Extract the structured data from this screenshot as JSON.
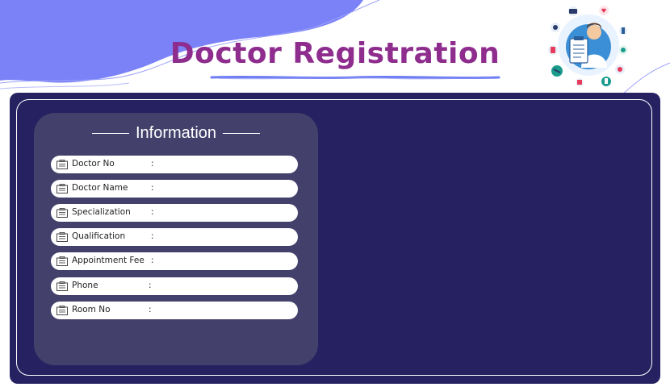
{
  "page": {
    "title": "Doctor Registration",
    "colors": {
      "title": "#8e2d8e",
      "blob": "#7b82f8",
      "panel": "#262262",
      "card": "#43406b",
      "underline": "#6f7cf2"
    }
  },
  "form": {
    "heading": "Information",
    "fields": [
      {
        "label": "Doctor No",
        "colon": ":",
        "value": ""
      },
      {
        "label": "Doctor Name",
        "colon": ":",
        "value": ""
      },
      {
        "label": "Specialization",
        "colon": ":",
        "value": ""
      },
      {
        "label": "Qualification",
        "colon": ":",
        "value": ""
      },
      {
        "label": "Appointment Fee",
        "colon": ":",
        "value": ""
      },
      {
        "label": "Phone",
        "colon": ":",
        "value": ""
      },
      {
        "label": "Room No",
        "colon": ":",
        "value": ""
      }
    ]
  },
  "icons": {
    "field_icon": "id-card-icon",
    "header_art": "doctor-illustration-icon"
  }
}
